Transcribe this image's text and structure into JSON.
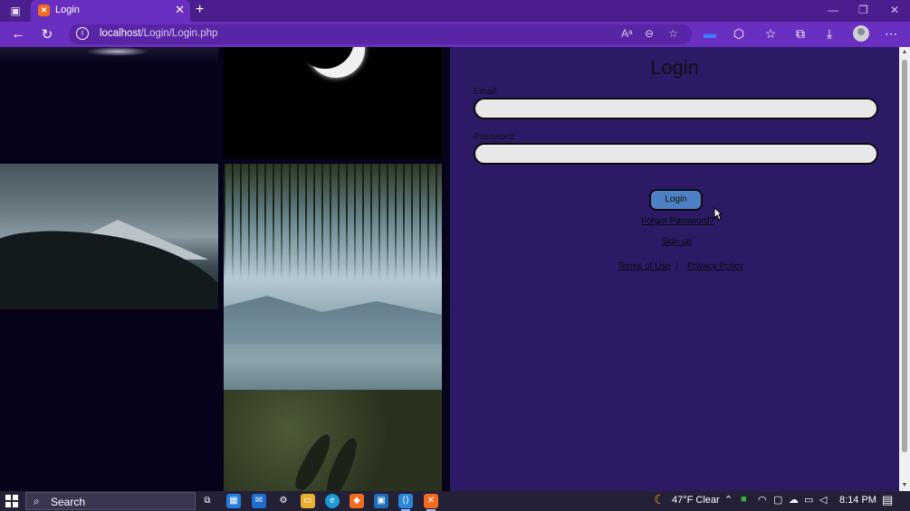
{
  "browser": {
    "tab_title": "Login",
    "tab_favicon": "xampp-icon",
    "url_host": "localhost",
    "url_path": "/Login/Login.php"
  },
  "login": {
    "title": "Login",
    "email_label": "Email:",
    "email_value": "",
    "password_label": "Password:",
    "password_value": "",
    "login_button": "Login",
    "forgot_password": "Forgot Password?",
    "sign_up": "Sign up",
    "terms": "Terms of Use",
    "separator": "|",
    "privacy": "Privacy Policy"
  },
  "taskbar": {
    "search_placeholder": "Search",
    "weather": "47°F  Clear",
    "time": "8:14 PM"
  },
  "colors": {
    "page_background": "#2c1a66",
    "browser_frame": "#6a2fc0",
    "login_button": "#4d80c4",
    "input_background": "#e8e8e8"
  }
}
